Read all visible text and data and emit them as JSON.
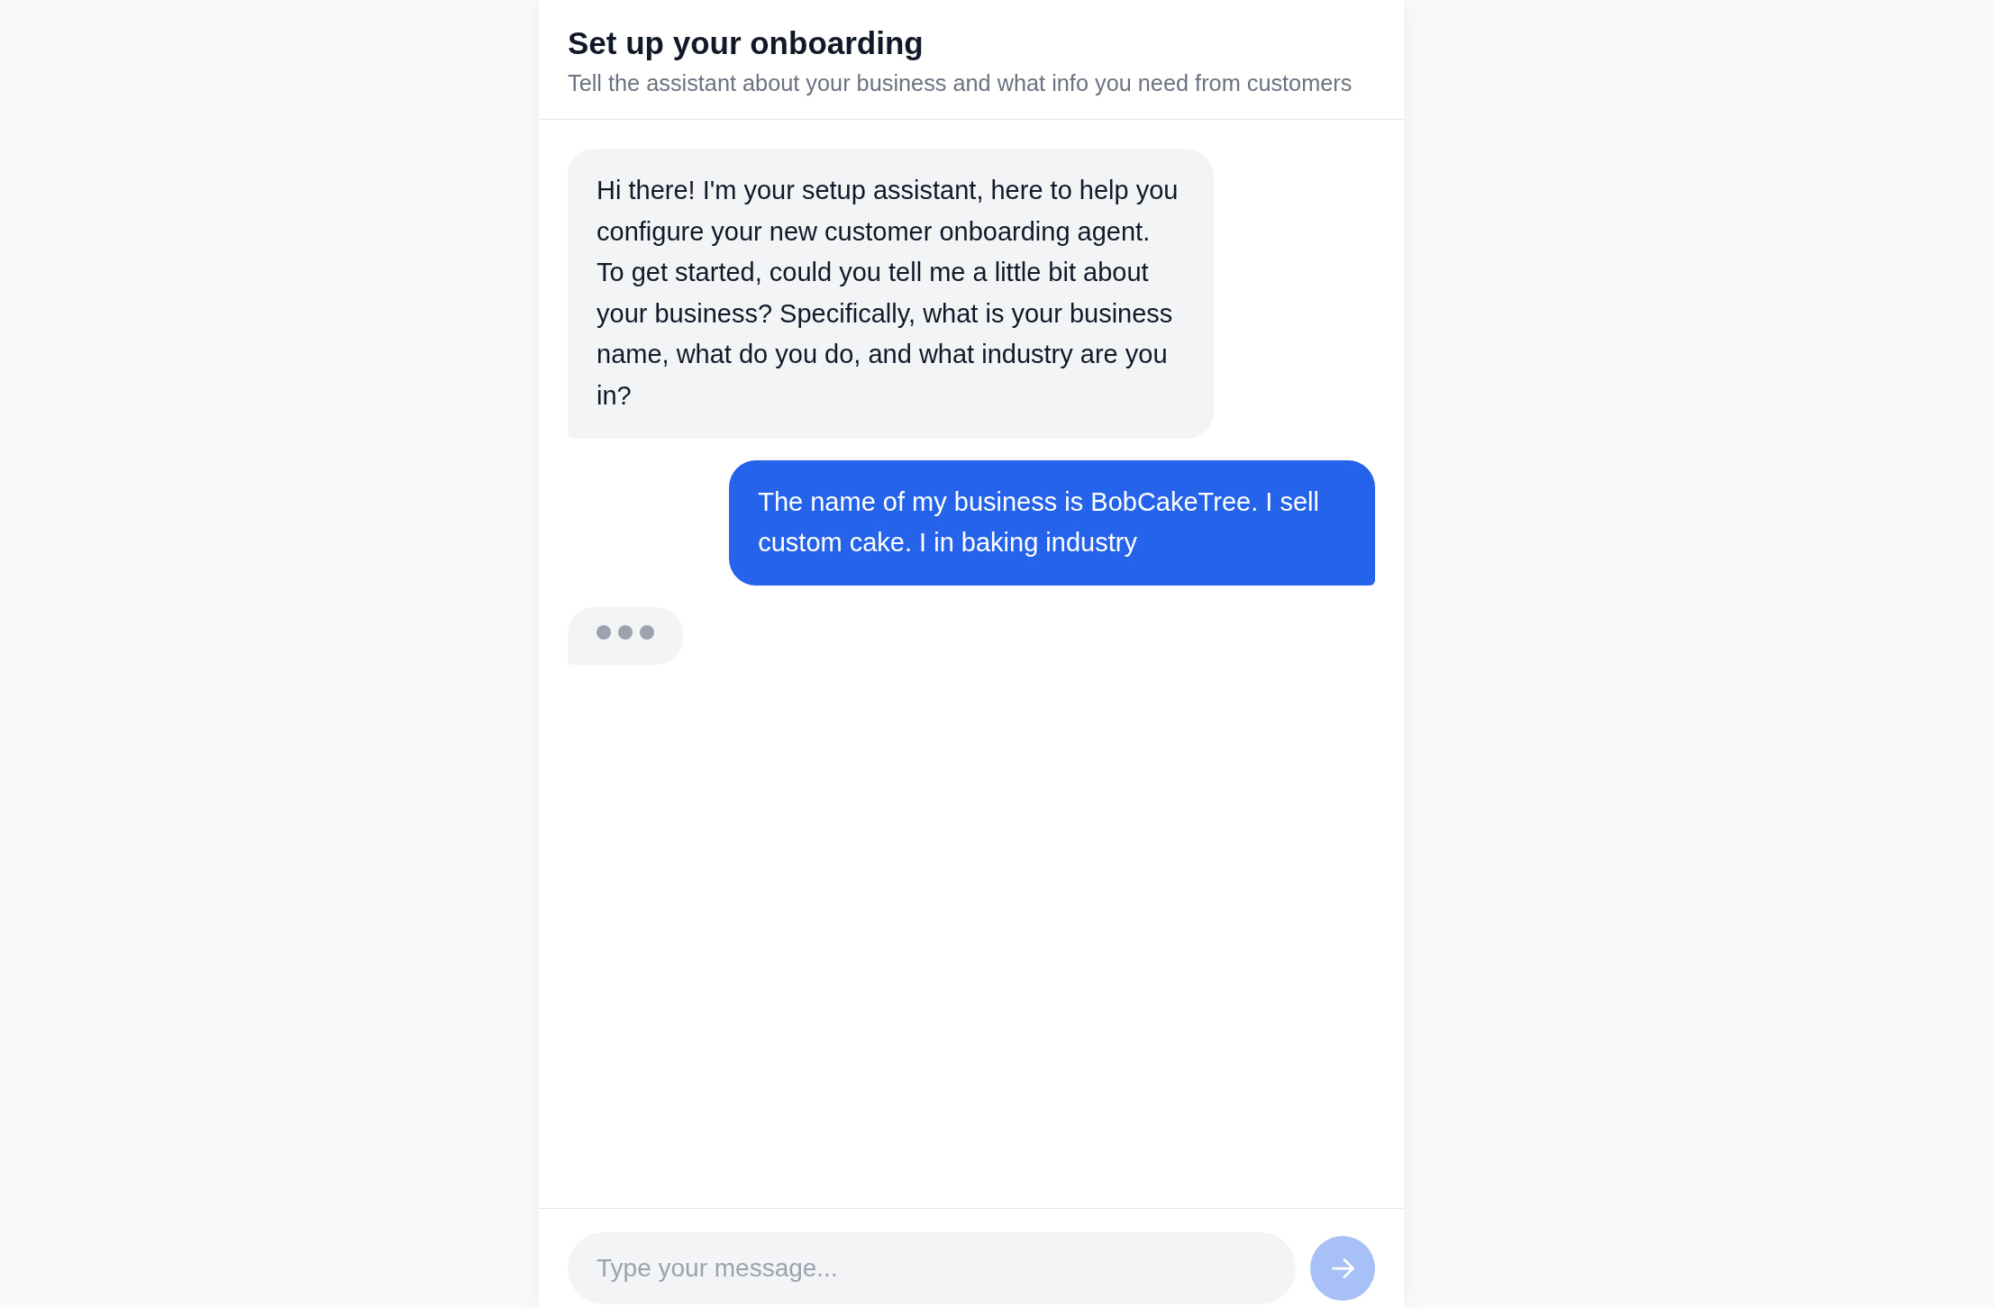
{
  "header": {
    "title": "Set up your onboarding",
    "subtitle": "Tell the assistant about your business and what info you need from customers"
  },
  "chat": {
    "messages": [
      {
        "kind": "assistant",
        "text": "Hi there! I'm your setup assistant, here to help you configure your new customer onboarding agent. To get started, could you tell me a little bit about your business? Specifically, what is your business name, what do you do, and what industry are you in?"
      },
      {
        "kind": "user",
        "text": "The name of my business is BobCakeTree. I sell custom cake. I in baking industry"
      }
    ],
    "typing": true
  },
  "composer": {
    "placeholder": "Type your message...",
    "send_button": {
      "disabled": true
    }
  }
}
